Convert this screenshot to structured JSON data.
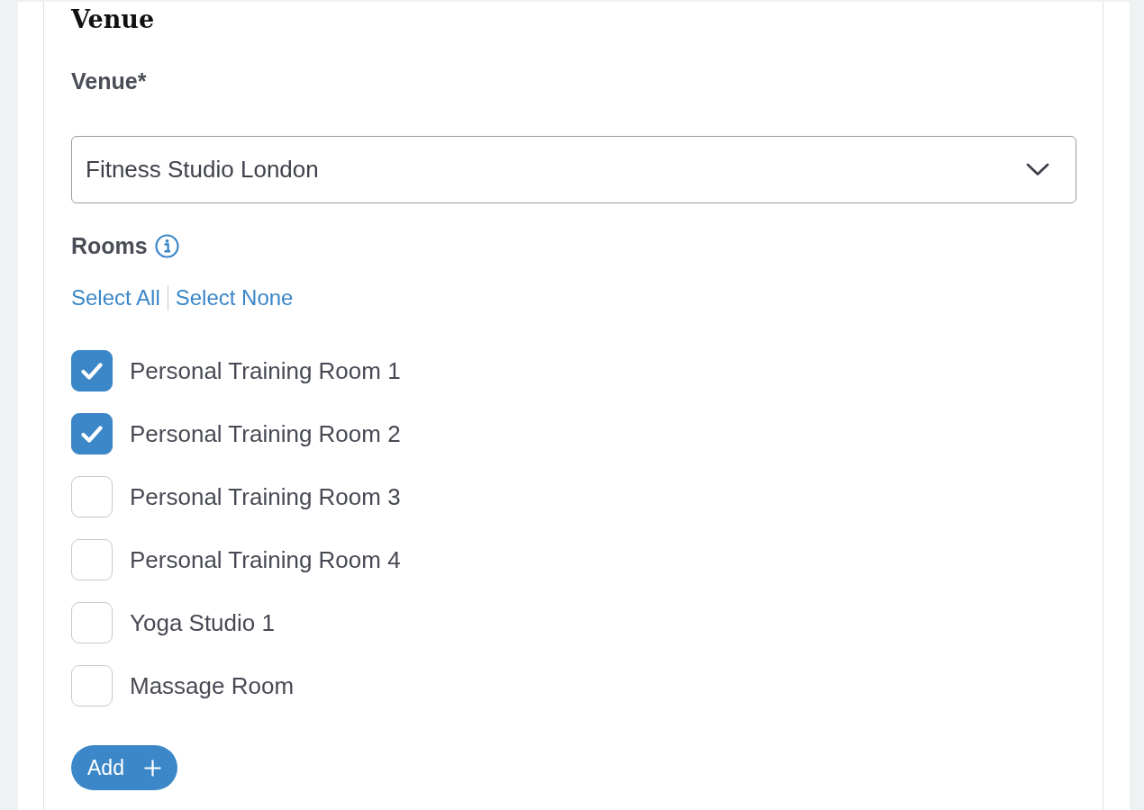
{
  "section": {
    "title": "Venue"
  },
  "venue_field": {
    "label": "Venue*",
    "value": "Fitness Studio London"
  },
  "rooms": {
    "label": "Rooms",
    "links": [
      "Select All",
      "Select None"
    ],
    "items": [
      {
        "label": "Personal Training Room 1",
        "checked": true
      },
      {
        "label": "Personal Training Room 2",
        "checked": true
      },
      {
        "label": "Personal Training Room 3",
        "checked": false
      },
      {
        "label": "Personal Training Room 4",
        "checked": false
      },
      {
        "label": "Yoga Studio 1",
        "checked": false
      },
      {
        "label": "Massage Room",
        "checked": false
      }
    ]
  },
  "add_button": {
    "label": "Add"
  }
}
